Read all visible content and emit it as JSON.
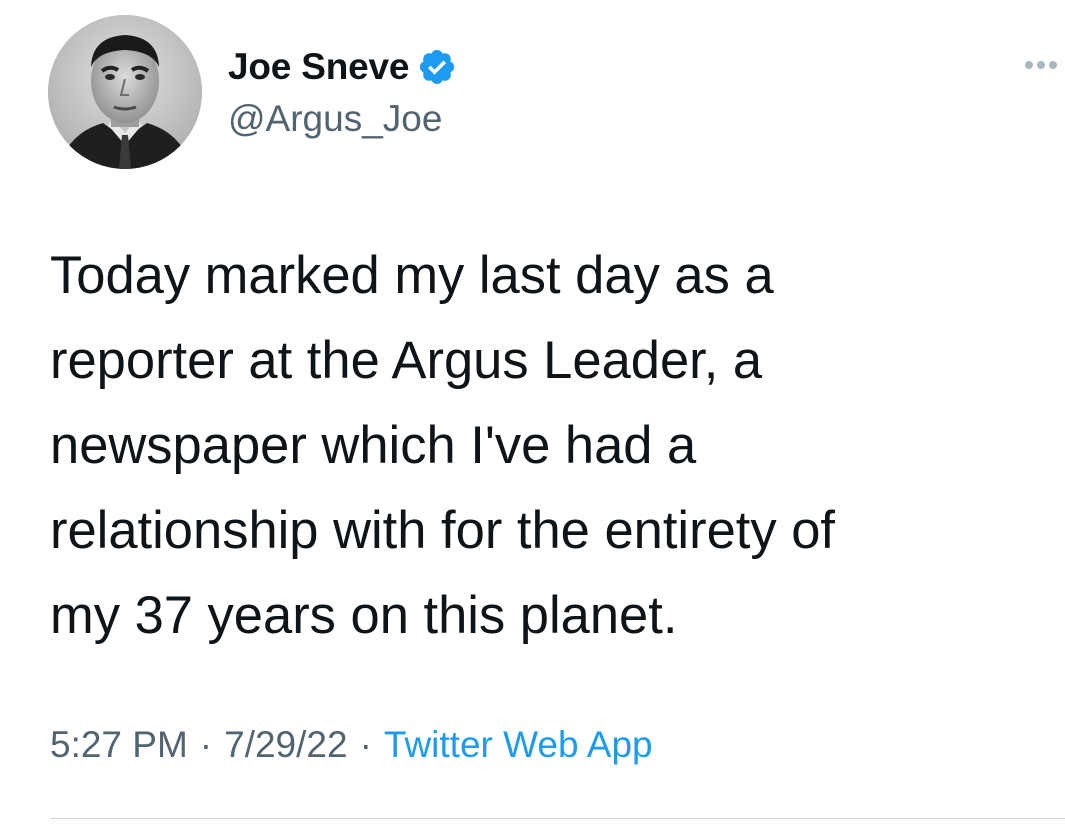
{
  "user": {
    "display_name": "Joe Sneve",
    "handle": "@Argus_Joe",
    "verified": true,
    "avatar_icon": "profile-photo"
  },
  "tweet": {
    "text_lines": [
      "Today marked my last day as a",
      "reporter at the Argus Leader, a",
      "newspaper which I've had a",
      "relationship with for the entirety of",
      "my 37 years on this planet."
    ]
  },
  "meta": {
    "time": "5:27 PM",
    "separator": "·",
    "date": "7/29/22",
    "source": "Twitter Web App"
  },
  "icons": {
    "verified": "verified-badge-icon",
    "more": "more-options-icon"
  },
  "colors": {
    "text": "#0f1419",
    "secondary": "#536471",
    "link": "#1d9bf0",
    "verified": "#1d9bf0"
  }
}
